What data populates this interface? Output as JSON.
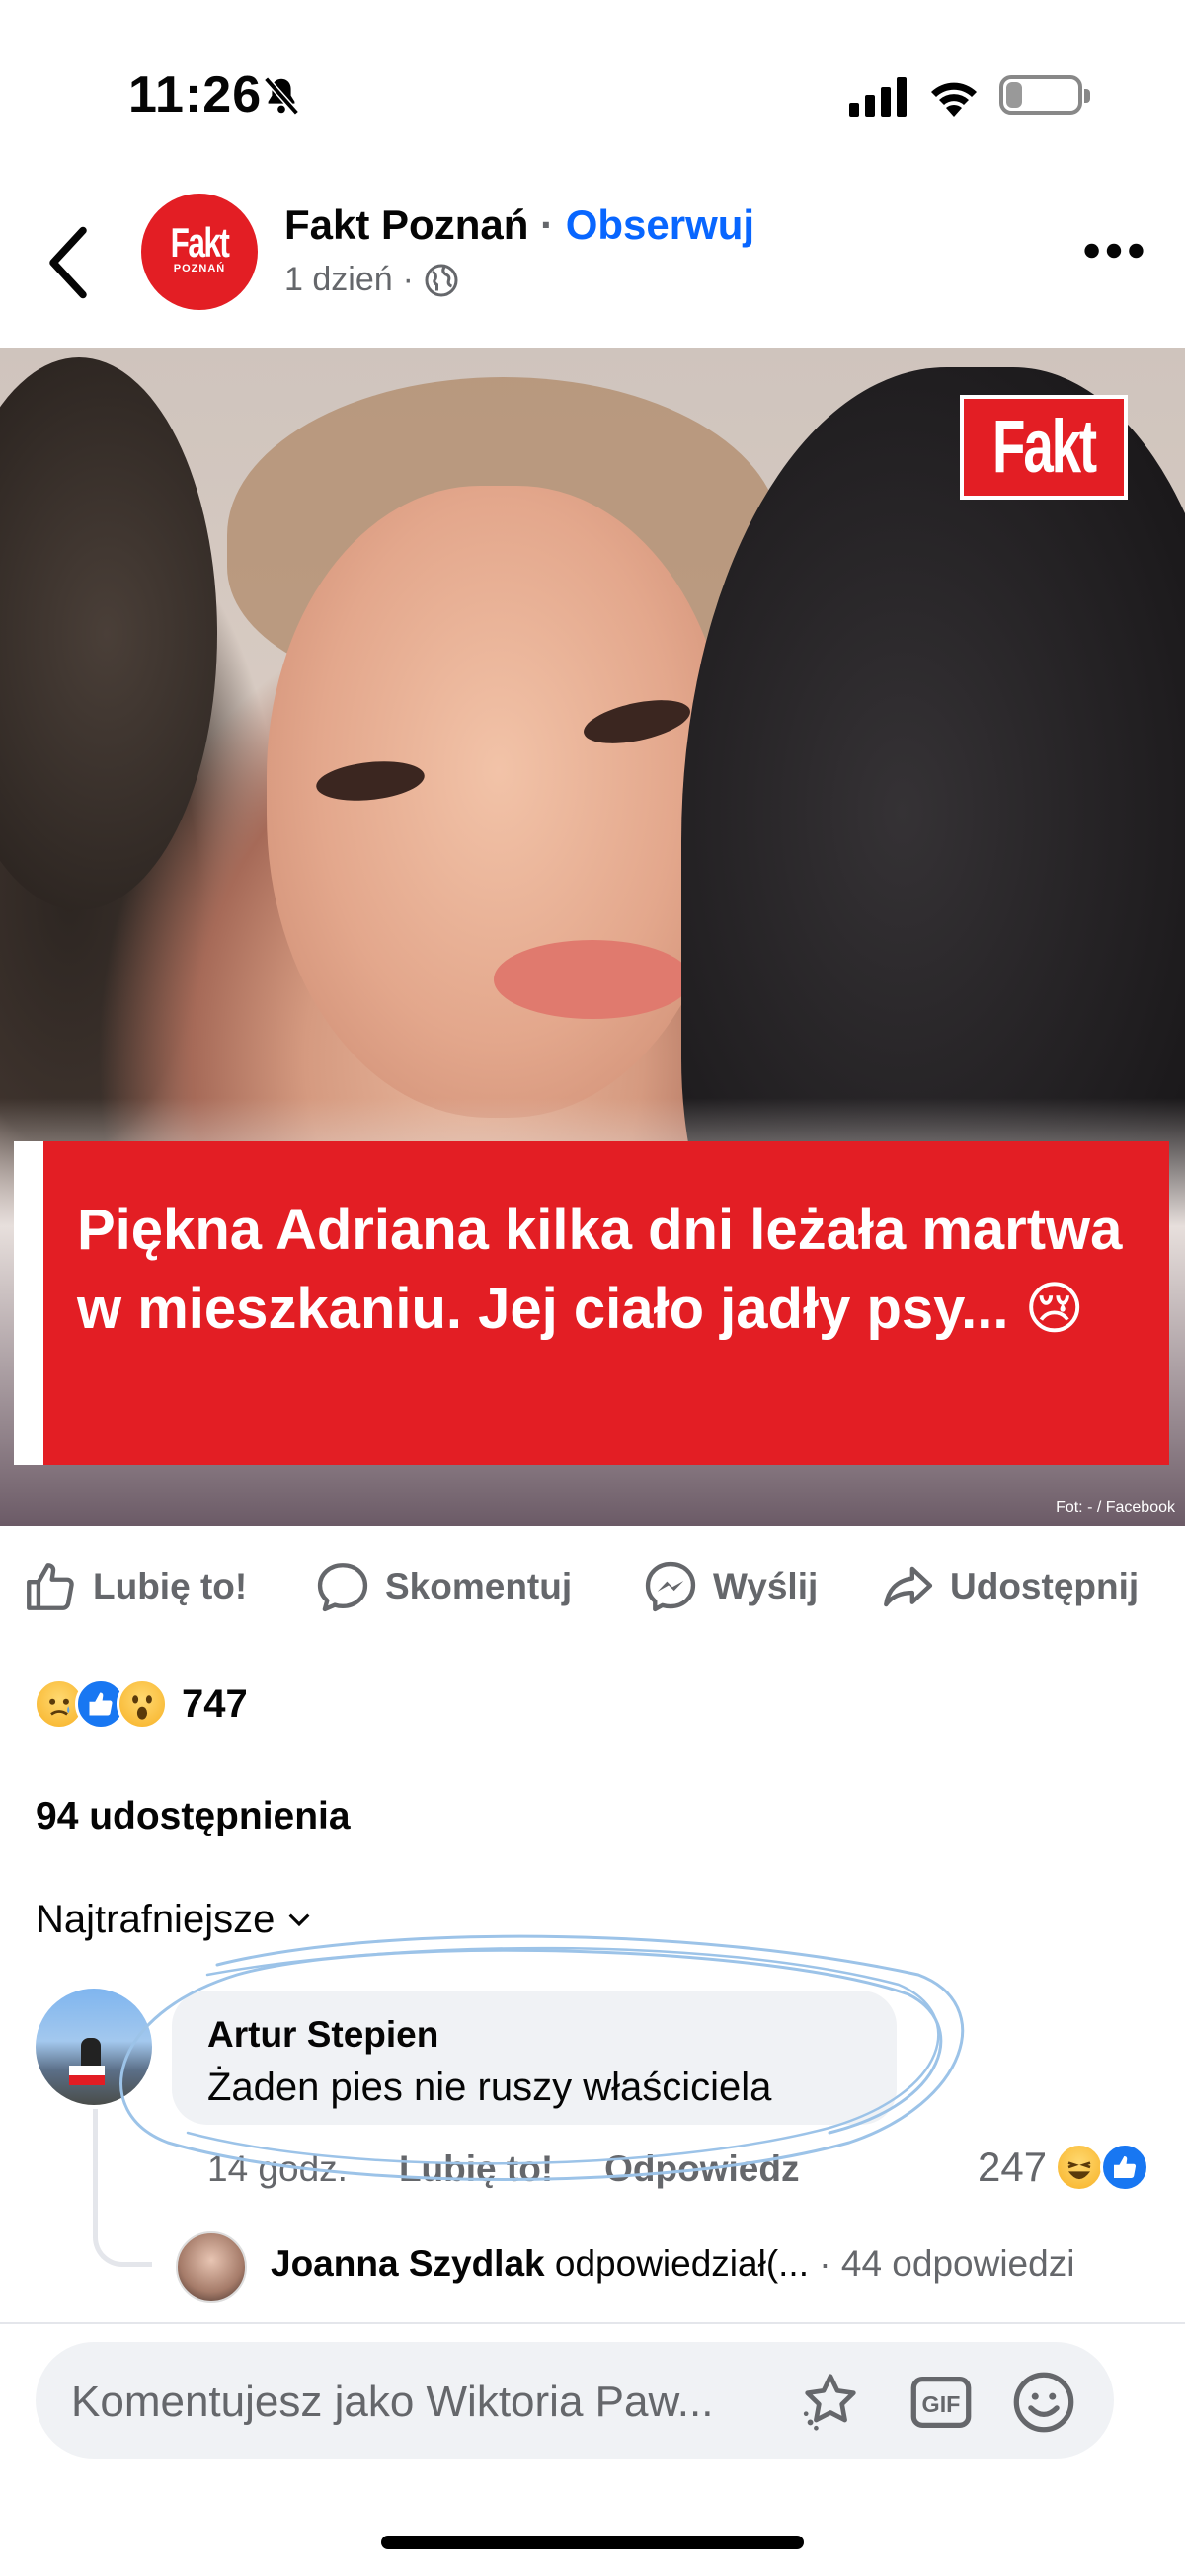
{
  "status_bar": {
    "time": "11:26",
    "battery": "21",
    "battery_level": 0.21
  },
  "post": {
    "page_name": "Fakt Poznań",
    "separator": "·",
    "follow_label": "Obserwuj",
    "time_ago": "1 dzień",
    "meta_separator": "·",
    "avatar_logo": "Fakt",
    "avatar_sub": "POZNAŃ",
    "image_logo": "Fakt",
    "headline": "Piękna Adriana kilka dni leżała martwa w mieszkaniu. Jej ciało jadły psy... 😢",
    "photo_credit": "Fot: - / Facebook"
  },
  "actions": {
    "like": "Lubię to!",
    "comment": "Skomentuj",
    "send": "Wyślij",
    "share": "Udostępnij"
  },
  "reactions": {
    "types": [
      "sad",
      "like",
      "wow"
    ],
    "count": "747"
  },
  "shares": "94 udostępnienia",
  "sort_label": "Najtrafniejsze",
  "comment": {
    "author": "Artur Stepien",
    "text": "Żaden pies nie ruszy właściciela",
    "time": "14 godz.",
    "like_label": "Lubię to!",
    "reply_label": "Odpowiedz",
    "reaction_count": "247",
    "reaction_types": [
      "haha",
      "like"
    ]
  },
  "reply": {
    "author": "Joanna Szydlak",
    "action": "odpowiedział(...",
    "separator": "·",
    "count_label": "44 odpowiedzi"
  },
  "composer": {
    "placeholder": "Komentujesz jako Wiktoria Paw..."
  },
  "colors": {
    "accent": "#0866ff",
    "fakt_red": "#e31e24",
    "secondary_text": "#65676b",
    "annotation": "#9cc3e8"
  }
}
